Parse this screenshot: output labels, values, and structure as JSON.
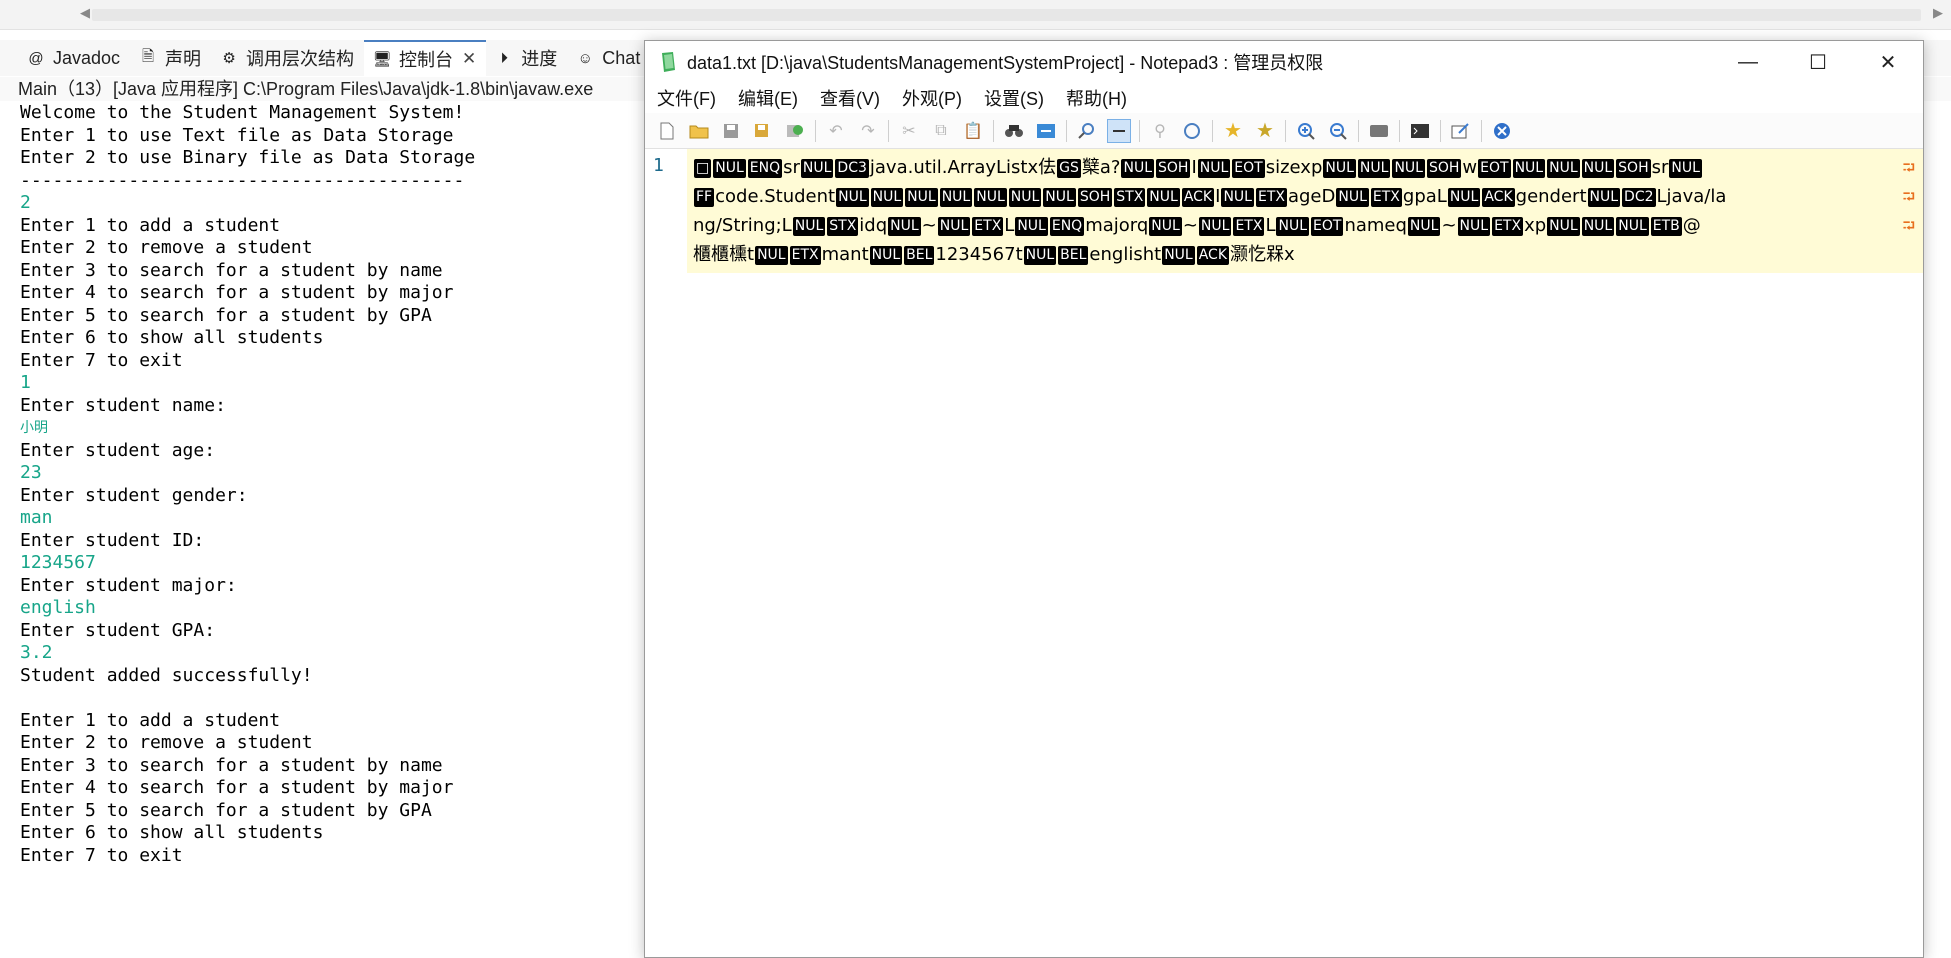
{
  "eclipse": {
    "tabs": [
      {
        "icon": "at-icon",
        "label": "Javadoc"
      },
      {
        "icon": "declaration-icon",
        "label": "声明"
      },
      {
        "icon": "call-hierarchy-icon",
        "label": "调用层次结构"
      },
      {
        "icon": "console-icon",
        "label": "控制台"
      },
      {
        "icon": "progress-icon",
        "label": "进度"
      },
      {
        "icon": "chat-icon",
        "label": "Chat"
      }
    ],
    "console_title": "Main（13）[Java 应用程序] C:\\Program Files\\Java\\jdk-1.8\\bin\\javaw.exe",
    "console_lines": [
      {
        "t": "out",
        "v": "Welcome to the Student Management System!"
      },
      {
        "t": "out",
        "v": "Enter 1 to use Text file as Data Storage"
      },
      {
        "t": "out",
        "v": "Enter 2 to use Binary file as Data Storage"
      },
      {
        "t": "out",
        "v": "-----------------------------------------"
      },
      {
        "t": "in",
        "v": "2"
      },
      {
        "t": "out",
        "v": "Enter 1 to add a student"
      },
      {
        "t": "out",
        "v": "Enter 2 to remove a student"
      },
      {
        "t": "out",
        "v": "Enter 3 to search for a student by name"
      },
      {
        "t": "out",
        "v": "Enter 4 to search for a student by major"
      },
      {
        "t": "out",
        "v": "Enter 5 to search for a student by GPA"
      },
      {
        "t": "out",
        "v": "Enter 6 to show all students"
      },
      {
        "t": "out",
        "v": "Enter 7 to exit"
      },
      {
        "t": "in",
        "v": "1"
      },
      {
        "t": "out",
        "v": "Enter student name:"
      },
      {
        "t": "in small",
        "v": "小明"
      },
      {
        "t": "out",
        "v": "Enter student age:"
      },
      {
        "t": "in",
        "v": "23"
      },
      {
        "t": "out",
        "v": "Enter student gender:"
      },
      {
        "t": "in",
        "v": "man"
      },
      {
        "t": "out",
        "v": "Enter student ID:"
      },
      {
        "t": "in",
        "v": "1234567"
      },
      {
        "t": "out",
        "v": "Enter student major:"
      },
      {
        "t": "in",
        "v": "english"
      },
      {
        "t": "out",
        "v": "Enter student GPA:"
      },
      {
        "t": "in",
        "v": "3.2"
      },
      {
        "t": "out",
        "v": "Student added successfully!"
      },
      {
        "t": "out",
        "v": ""
      },
      {
        "t": "out",
        "v": "Enter 1 to add a student"
      },
      {
        "t": "out",
        "v": "Enter 2 to remove a student"
      },
      {
        "t": "out",
        "v": "Enter 3 to search for a student by name"
      },
      {
        "t": "out",
        "v": "Enter 4 to search for a student by major"
      },
      {
        "t": "out",
        "v": "Enter 5 to search for a student by GPA"
      },
      {
        "t": "out",
        "v": "Enter 6 to show all students"
      },
      {
        "t": "out",
        "v": "Enter 7 to exit"
      }
    ]
  },
  "notepad": {
    "title": "data1.txt [D:\\java\\StudentsManagementSystemProject] - Notepad3 : 管理员权限",
    "minimize": "—",
    "maximize": "☐",
    "close": "✕",
    "menu": [
      "文件(F)",
      "编辑(E)",
      "查看(V)",
      "外观(P)",
      "设置(S)",
      "帮助(H)"
    ],
    "line_number": "1",
    "editor_lines": [
      [
        {
          "c": 1,
          "v": "□"
        },
        {
          "c": 1,
          "v": "NUL"
        },
        {
          "c": 1,
          "v": "ENQ"
        },
        {
          "v": "sr"
        },
        {
          "c": 1,
          "v": "NUL"
        },
        {
          "c": 1,
          "v": "DC3"
        },
        {
          "v": "java.util.ArrayListx佉"
        },
        {
          "c": 1,
          "v": "GS"
        },
        {
          "v": "櫱a?"
        },
        {
          "c": 1,
          "v": "NUL"
        },
        {
          "c": 1,
          "v": "SOH"
        },
        {
          "v": "I"
        },
        {
          "c": 1,
          "v": "NUL"
        },
        {
          "c": 1,
          "v": "EOT"
        },
        {
          "v": "sizexp"
        },
        {
          "c": 1,
          "v": "NUL"
        },
        {
          "c": 1,
          "v": "NUL"
        },
        {
          "c": 1,
          "v": "NUL"
        },
        {
          "c": 1,
          "v": "SOH"
        },
        {
          "v": "w"
        },
        {
          "c": 1,
          "v": "EOT"
        },
        {
          "c": 1,
          "v": "NUL"
        },
        {
          "c": 1,
          "v": "NUL"
        },
        {
          "c": 1,
          "v": "NUL"
        },
        {
          "c": 1,
          "v": "SOH"
        },
        {
          "v": "sr"
        },
        {
          "c": 1,
          "v": "NUL"
        }
      ],
      [
        {
          "c": 1,
          "v": "FF"
        },
        {
          "v": "code.Student"
        },
        {
          "c": 1,
          "v": "NUL"
        },
        {
          "c": 1,
          "v": "NUL"
        },
        {
          "c": 1,
          "v": "NUL"
        },
        {
          "c": 1,
          "v": "NUL"
        },
        {
          "c": 1,
          "v": "NUL"
        },
        {
          "c": 1,
          "v": "NUL"
        },
        {
          "c": 1,
          "v": "NUL"
        },
        {
          "c": 1,
          "v": "SOH"
        },
        {
          "c": 1,
          "v": "STX"
        },
        {
          "c": 1,
          "v": "NUL"
        },
        {
          "c": 1,
          "v": "ACK"
        },
        {
          "v": "I"
        },
        {
          "c": 1,
          "v": "NUL"
        },
        {
          "c": 1,
          "v": "ETX"
        },
        {
          "v": "ageD"
        },
        {
          "c": 1,
          "v": "NUL"
        },
        {
          "c": 1,
          "v": "ETX"
        },
        {
          "v": "gpaL"
        },
        {
          "c": 1,
          "v": "NUL"
        },
        {
          "c": 1,
          "v": "ACK"
        },
        {
          "v": "gendert"
        },
        {
          "c": 1,
          "v": "NUL"
        },
        {
          "c": 1,
          "v": "DC2"
        },
        {
          "v": "Ljava/la"
        }
      ],
      [
        {
          "v": "ng/String;L"
        },
        {
          "c": 1,
          "v": "NUL"
        },
        {
          "c": 1,
          "v": "STX"
        },
        {
          "v": "idq"
        },
        {
          "c": 1,
          "v": "NUL"
        },
        {
          "v": "~"
        },
        {
          "c": 1,
          "v": "NUL"
        },
        {
          "c": 1,
          "v": "ETX"
        },
        {
          "v": "L"
        },
        {
          "c": 1,
          "v": "NUL"
        },
        {
          "c": 1,
          "v": "ENQ"
        },
        {
          "v": "majorq"
        },
        {
          "c": 1,
          "v": "NUL"
        },
        {
          "v": "~"
        },
        {
          "c": 1,
          "v": "NUL"
        },
        {
          "c": 1,
          "v": "ETX"
        },
        {
          "v": "L"
        },
        {
          "c": 1,
          "v": "NUL"
        },
        {
          "c": 1,
          "v": "EOT"
        },
        {
          "v": "nameq"
        },
        {
          "c": 1,
          "v": "NUL"
        },
        {
          "v": "~"
        },
        {
          "c": 1,
          "v": "NUL"
        },
        {
          "c": 1,
          "v": "ETX"
        },
        {
          "v": "xp"
        },
        {
          "c": 1,
          "v": "NUL"
        },
        {
          "c": 1,
          "v": "NUL"
        },
        {
          "c": 1,
          "v": "NUL"
        },
        {
          "c": 1,
          "v": "ETB"
        },
        {
          "v": "@"
        }
      ],
      [
        {
          "v": "櫃櫃櫄t"
        },
        {
          "c": 1,
          "v": "NUL"
        },
        {
          "c": 1,
          "v": "ETX"
        },
        {
          "v": "mant"
        },
        {
          "c": 1,
          "v": "NUL"
        },
        {
          "c": 1,
          "v": "BEL"
        },
        {
          "v": "1234567t"
        },
        {
          "c": 1,
          "v": "NUL"
        },
        {
          "c": 1,
          "v": "BEL"
        },
        {
          "v": "englisht"
        },
        {
          "c": 1,
          "v": "NUL"
        },
        {
          "c": 1,
          "v": "ACK"
        },
        {
          "v": "灏忔槑x"
        }
      ]
    ],
    "wrap_marker": "⮒"
  }
}
